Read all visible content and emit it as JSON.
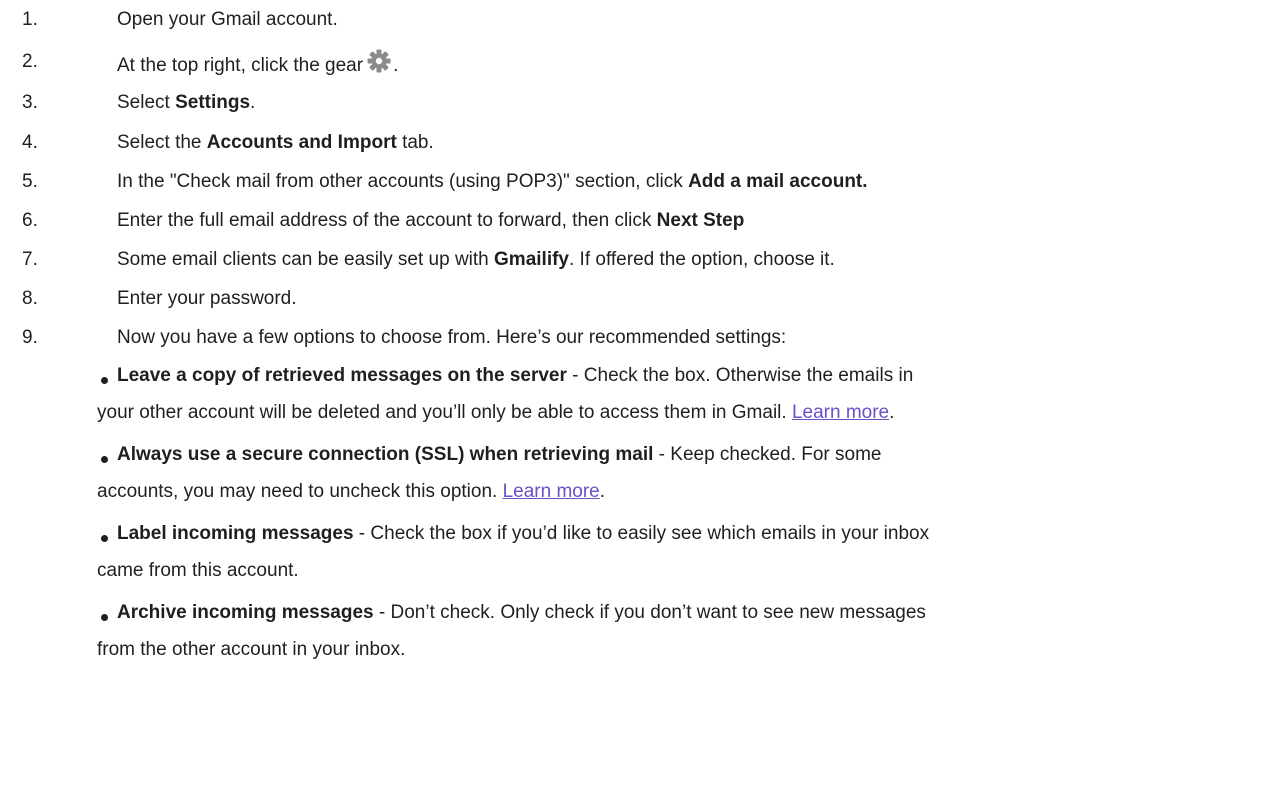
{
  "steps": [
    {
      "number": "1.",
      "parts": [
        "Open your Gmail account.",
        "",
        ""
      ]
    },
    {
      "number": "2.",
      "parts": [
        "At the top right, click the gear",
        "",
        "."
      ]
    },
    {
      "number": "3.",
      "parts": [
        "Select ",
        "Settings",
        "."
      ]
    },
    {
      "number": "4.",
      "parts": [
        "Select the ",
        "Accounts and Import",
        " tab."
      ]
    },
    {
      "number": "5.",
      "parts": [
        "In the \"Check mail from other accounts (using POP3)\" section, click ",
        "Add a mail account.",
        ""
      ]
    },
    {
      "number": "6.",
      "parts": [
        "Enter the full email address of the account to forward, then click ",
        "Next Step",
        ""
      ]
    },
    {
      "number": "7.",
      "parts": [
        "Some email clients can be easily set up with ",
        "Gmailify",
        ". If offered the option, choose it."
      ]
    },
    {
      "number": "8.",
      "parts": [
        "Enter your password.",
        "",
        ""
      ]
    },
    {
      "number": "9.",
      "parts": [
        "Now you have a few options to choose from. Here’s our recommended settings:",
        "",
        ""
      ]
    }
  ],
  "gear_icon": "gear-icon",
  "link_color": "#6a4fc7",
  "options": [
    {
      "title": "Leave a copy of retrieved messages on the server",
      "line1_rest": " - Check the box. Otherwise the emails in",
      "line2": "your other account will be deleted and you’ll only be able to access them in Gmail. ",
      "link": "Learn more",
      "after_link": "."
    },
    {
      "title": "Always use a secure connection (SSL) when retrieving mail",
      "line1_rest": " - Keep checked. For some",
      "line2": "accounts, you may need to uncheck this option. ",
      "link": "Learn more",
      "after_link": "."
    },
    {
      "title": "Label incoming messages",
      "line1_rest": " - Check the box if you’d like to easily see which emails in your inbox",
      "line2": "came from this account.",
      "link": "",
      "after_link": ""
    },
    {
      "title": "Archive incoming messages",
      "line1_rest": " - Don’t check. Only check if you don’t want to see new messages",
      "line2": "from the other account in your inbox.",
      "link": "",
      "after_link": ""
    }
  ]
}
